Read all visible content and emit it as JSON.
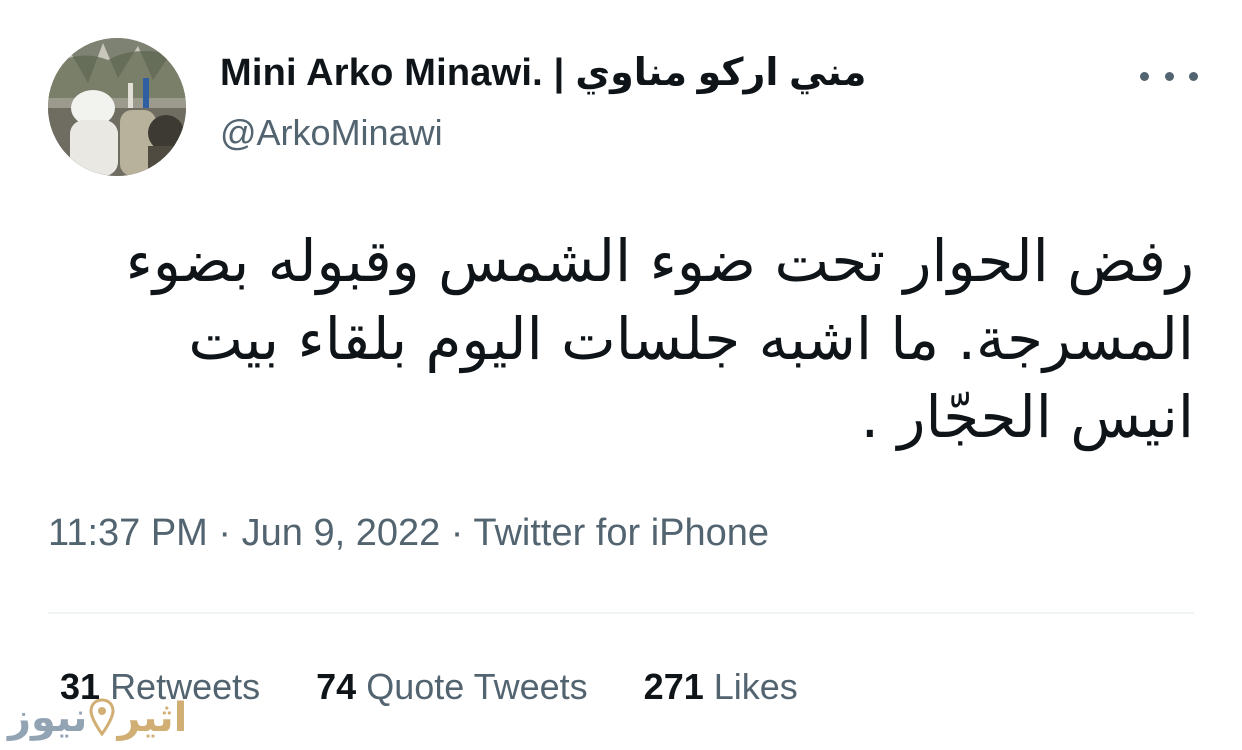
{
  "author": {
    "display_name": "Mini Arko Minawi. | مني اركو مناوي",
    "handle": "@ArkoMinawi"
  },
  "tweet": {
    "text": "رفض الحوار تحت ضوء الشمس وقبوله بضوء المسرجة. ما اشبه جلسات اليوم بلقاء بيت انيس الحجّار ."
  },
  "meta": {
    "time": "11:37 PM",
    "separator": "·",
    "date": "Jun 9, 2022",
    "source": "Twitter for iPhone"
  },
  "stats": {
    "retweets_count": "31",
    "retweets_label": "Retweets",
    "quotes_count": "74",
    "quotes_label": "Quote Tweets",
    "likes_count": "271",
    "likes_label": "Likes"
  },
  "watermark": {
    "word_one": "اثير",
    "word_two": "نيوز",
    "color_one": "#c9a25c",
    "color_two": "#7f93a8"
  },
  "icons": {
    "more": "more-horizontal-icon",
    "watermark_pin": "location-pin-icon"
  },
  "colors": {
    "text_primary": "#0f1419",
    "text_secondary": "#536471",
    "divider": "#eff3f4"
  }
}
